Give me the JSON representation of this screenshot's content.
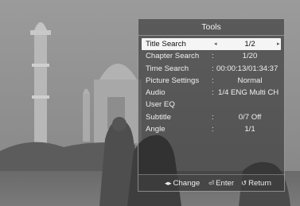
{
  "panel": {
    "title": "Tools",
    "items": [
      {
        "label": "Title Search",
        "colon": "",
        "value": "1/2",
        "selected": true
      },
      {
        "label": "Chapter Search",
        "colon": ":",
        "value": "1/20"
      },
      {
        "label": "Time Search",
        "colon": ":",
        "value": "00:00:13/01:34:37"
      },
      {
        "label": "Picture Settings",
        "colon": ":",
        "value": "Normal"
      },
      {
        "label": "Audio",
        "colon": ":",
        "value": "1/4 ENG Multi CH"
      },
      {
        "label": "User EQ",
        "colon": "",
        "value": ""
      },
      {
        "label": "Subtitle",
        "colon": ":",
        "value": "0/7 Off"
      },
      {
        "label": "Angle",
        "colon": ":",
        "value": "1/1"
      }
    ],
    "arrow_left": "◂",
    "arrow_right": "▸"
  },
  "footer": {
    "change_glyph": "◂▸",
    "change_label": "Change",
    "enter_glyph": "⏎",
    "enter_label": "Enter",
    "return_glyph": "↺",
    "return_label": "Return"
  },
  "colors": {
    "panel_bg": "#282828",
    "selected_bg": "#f5f5f5",
    "text": "#f0f0f0"
  },
  "icons": {
    "change": "left-right-arrows-icon",
    "enter": "enter-icon",
    "return": "return-icon"
  }
}
